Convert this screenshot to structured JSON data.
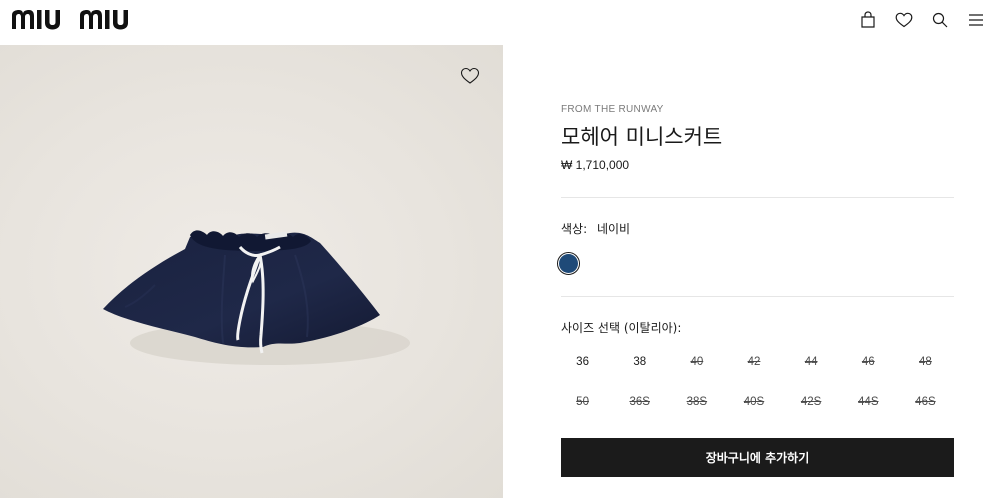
{
  "header": {
    "logo_text": "miu miu",
    "icons": [
      "bag-icon",
      "heart-icon",
      "search-icon",
      "menu-icon"
    ]
  },
  "product": {
    "eyebrow": "FROM THE RUNWAY",
    "title": "모헤어 미니스커트",
    "price": "₩ 1,710,000",
    "color_label": "색상:",
    "color_value": "네이비",
    "color_hex": "#1f4a78",
    "size_label": "사이즈 선택 (이탈리아):",
    "sizes": [
      [
        {
          "label": "36",
          "available": true
        },
        {
          "label": "38",
          "available": true
        },
        {
          "label": "40",
          "available": false
        },
        {
          "label": "42",
          "available": false
        },
        {
          "label": "44",
          "available": false
        },
        {
          "label": "46",
          "available": false
        },
        {
          "label": "48",
          "available": false
        }
      ],
      [
        {
          "label": "50",
          "available": false
        },
        {
          "label": "36S",
          "available": false
        },
        {
          "label": "38S",
          "available": false
        },
        {
          "label": "40S",
          "available": false
        },
        {
          "label": "42S",
          "available": false
        },
        {
          "label": "44S",
          "available": false
        },
        {
          "label": "46S",
          "available": false
        }
      ]
    ],
    "cart_button": "장바구니에 추가하기"
  },
  "colors": {
    "skirt_navy": "#1c2440",
    "background": "#e9e5df",
    "button_bg": "#1b1b1b"
  }
}
